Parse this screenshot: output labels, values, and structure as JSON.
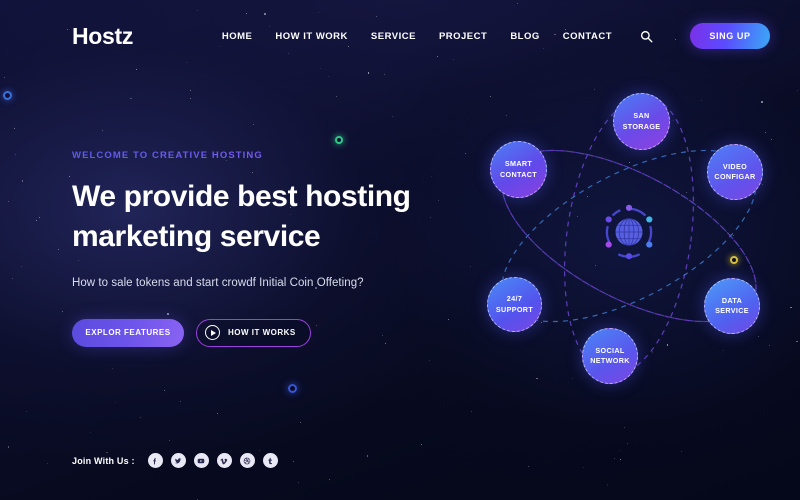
{
  "header": {
    "logo": "Hostz",
    "nav": [
      {
        "label": "HOME"
      },
      {
        "label": "HOW IT WORK"
      },
      {
        "label": "SERVICE"
      },
      {
        "label": "PROJECT"
      },
      {
        "label": "BLOG"
      },
      {
        "label": "CONTACT"
      }
    ],
    "search_icon": "search-icon",
    "signup_label": "SING UP"
  },
  "hero": {
    "eyebrow": "WELCOME TO CREATIVE HOSTING",
    "title_line1": "We provide best hosting",
    "title_line2": "marketing service",
    "subtitle": "How to sale tokens and start crowdf Initial Coin Offeting?",
    "primary_cta": "EXPLOR FEATURES",
    "secondary_cta": "HOW IT WORKS",
    "play_icon": "play-icon"
  },
  "social": {
    "label": "Join With Us :",
    "items": [
      {
        "name": "facebook-icon"
      },
      {
        "name": "twitter-icon"
      },
      {
        "name": "youtube-icon"
      },
      {
        "name": "vimeo-icon"
      },
      {
        "name": "dribbble-icon"
      },
      {
        "name": "tumblr-icon"
      }
    ]
  },
  "atom": {
    "center_icon": "globe-icon",
    "nodes": [
      {
        "id": "san",
        "line1": "SAN",
        "line2": "STORAGE"
      },
      {
        "id": "video",
        "line1": "VIDEO",
        "line2": "CONFIGAR"
      },
      {
        "id": "data",
        "line1": "DATA",
        "line2": "SERVICE"
      },
      {
        "id": "social",
        "line1": "SOCIAL",
        "line2": "NETWORK"
      },
      {
        "id": "support",
        "line1": "24/7",
        "line2": "SUPPORT"
      },
      {
        "id": "smart",
        "line1": "SMART",
        "line2": "CONTACT"
      }
    ]
  },
  "colors": {
    "background": "#080b20",
    "accent_purple": "#7b30e8",
    "accent_blue": "#3aa9f5",
    "text": "#ffffff",
    "orbit_purple": "#6b3fd4",
    "orbit_blue": "#3f7fd8"
  }
}
